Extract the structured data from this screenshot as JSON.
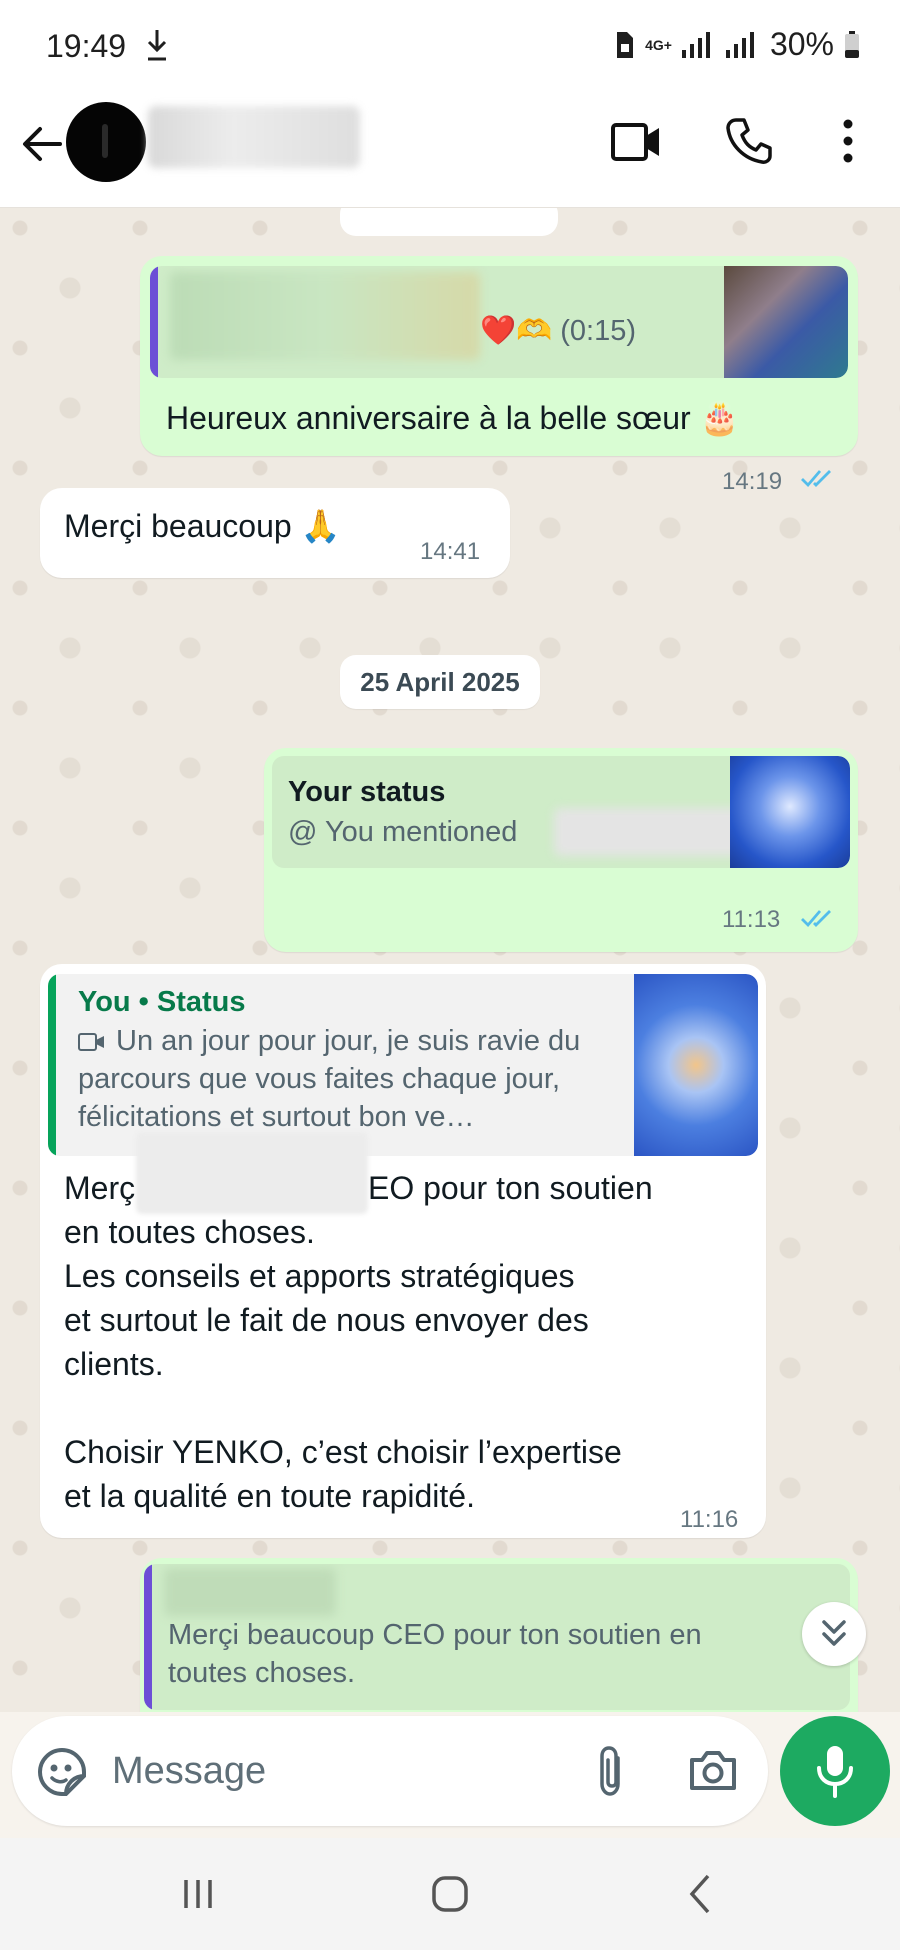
{
  "status_bar": {
    "time": "19:49",
    "network": "4G+",
    "battery": "30%"
  },
  "header": {
    "contact_name": ""
  },
  "messages": [
    {
      "direction": "outgoing",
      "quote_meta": "❤️🫶 (0:15)",
      "text": "Heureux anniversaire à la belle sœur 🎂",
      "time": "14:19",
      "read": true
    },
    {
      "direction": "incoming",
      "text": "Merçi beaucoup 🙏",
      "time": "14:41"
    },
    {
      "direction": "outgoing",
      "quote_title": "Your status",
      "quote_text": "@ You mentioned",
      "time": "11:13",
      "read": true
    },
    {
      "direction": "incoming",
      "quote_title": "You • Status",
      "quote_text": "Un an jour pour jour,  je suis ravie du parcours que vous faites chaque jour,  félicitations et surtout bon ve…",
      "text_line1": "Merç",
      "text_line1_end": "EO pour ton soutien",
      "text_rest": "en toutes choses.\nLes conseils et apports stratégiques\net surtout le fait de nous envoyer des\nclients.\n\nChoisir YENKO, c’est choisir l’expertise\net la qualité en toute rapidité.",
      "time": "11:16"
    },
    {
      "direction": "outgoing",
      "quote_text": "Merçi beaucoup CEO pour ton soutien en toutes choses."
    }
  ],
  "date_separator": "25 April 2025",
  "composer": {
    "placeholder": "Message"
  },
  "colors": {
    "outgoing_bubble": "#d9fdd3",
    "incoming_bubble": "#ffffff",
    "accent_green": "#1daa61",
    "read_ticks": "#53bdeb"
  }
}
